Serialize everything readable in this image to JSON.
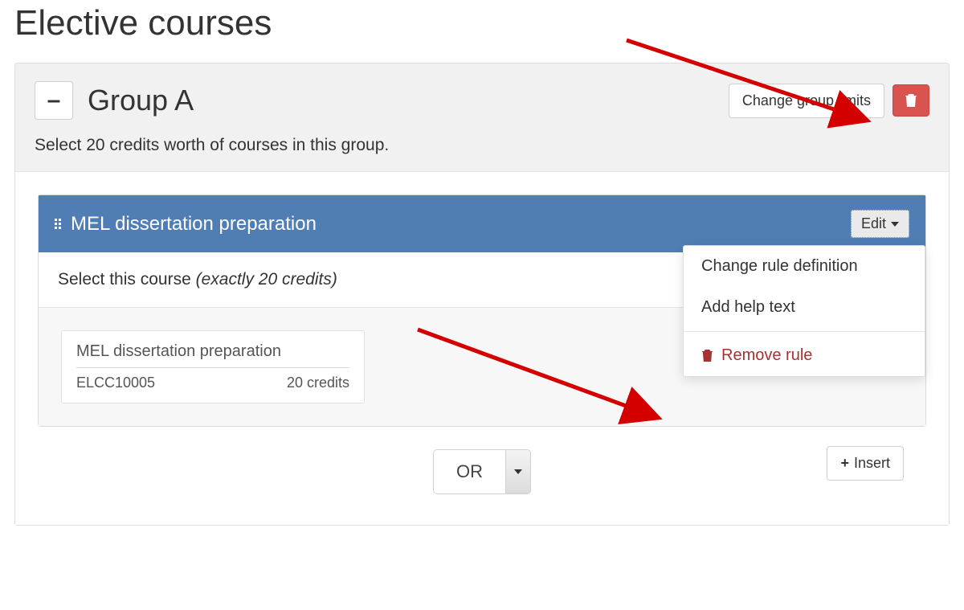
{
  "page": {
    "title": "Elective courses"
  },
  "group": {
    "collapse_symbol": "–",
    "title": "Group A",
    "change_limits_label": "Change group limits",
    "subtitle": "Select 20 credits worth of courses in this group."
  },
  "rule": {
    "title": "MEL dissertation preparation",
    "edit_label": "Edit",
    "desc_prefix": "Select this course ",
    "desc_italic": "(exactly 20 credits)"
  },
  "course": {
    "name": "MEL dissertation preparation",
    "code": "ELCC10005",
    "credits": "20 credits"
  },
  "dropdown": {
    "change_def": "Change rule definition",
    "add_help": "Add help text",
    "remove_rule": "Remove rule"
  },
  "or_row": {
    "selected": "OR",
    "insert_label": "Insert"
  },
  "colors": {
    "rule_header_bg": "#4f7db4",
    "danger_bg": "#d9534f",
    "danger_text": "#a63232",
    "arrow_red": "#d40000"
  }
}
